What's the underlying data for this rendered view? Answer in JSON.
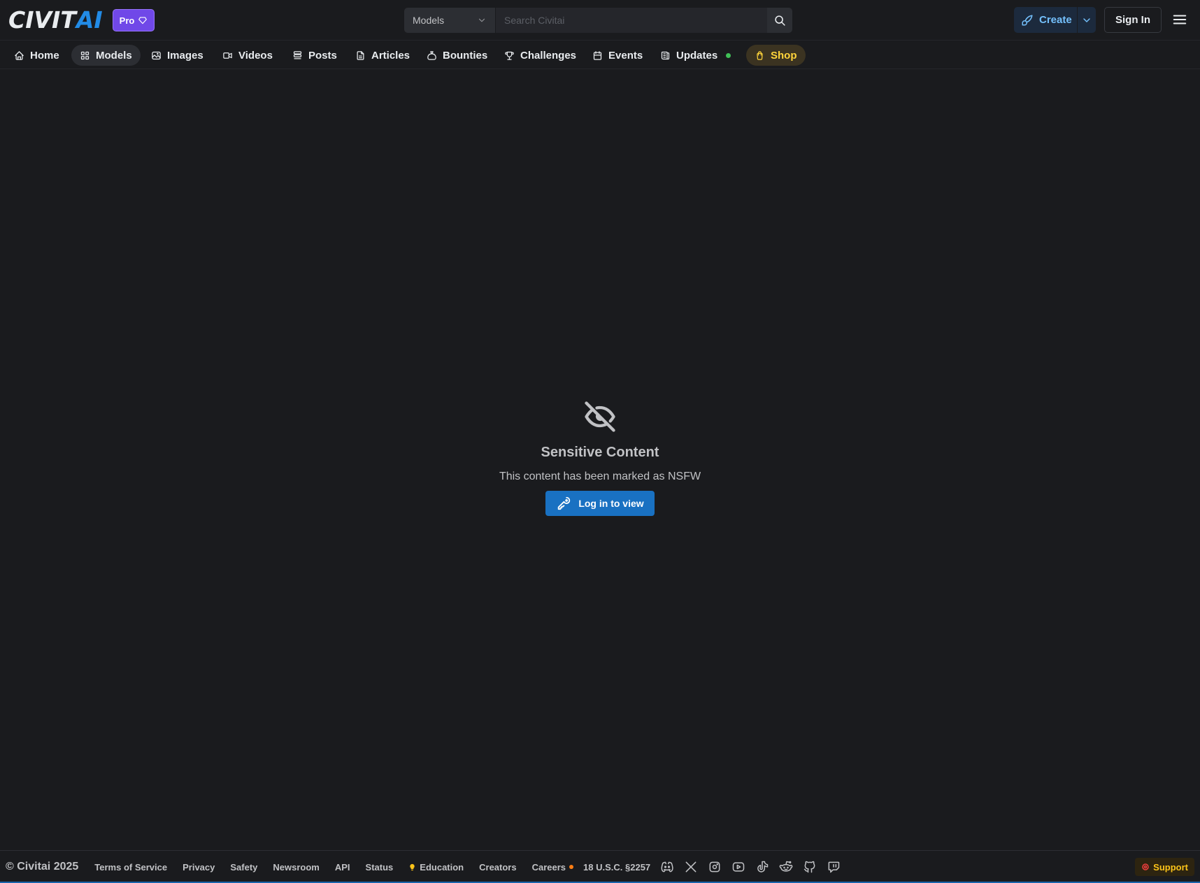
{
  "header": {
    "logo_main": "CIVIT",
    "logo_accent": "AI",
    "pro_label": "Pro",
    "search_type": "Models",
    "search_placeholder": "Search Civitai",
    "search_shortcut": "/",
    "create_label": "Create",
    "signin_label": "Sign In"
  },
  "nav": {
    "items": [
      {
        "label": "Home",
        "icon": "home-icon"
      },
      {
        "label": "Models",
        "icon": "grid-icon"
      },
      {
        "label": "Images",
        "icon": "photo-icon"
      },
      {
        "label": "Videos",
        "icon": "video-icon"
      },
      {
        "label": "Posts",
        "icon": "posts-icon"
      },
      {
        "label": "Articles",
        "icon": "file-text-icon"
      },
      {
        "label": "Bounties",
        "icon": "moneybag-icon"
      },
      {
        "label": "Challenges",
        "icon": "trophy-icon"
      },
      {
        "label": "Events",
        "icon": "calendar-icon"
      },
      {
        "label": "Updates",
        "icon": "news-icon"
      },
      {
        "label": "Shop",
        "icon": "shopping-bag-icon"
      }
    ],
    "active": "Models",
    "updates_dot_color": "#40c057",
    "shop_color": "#ffd43b"
  },
  "main": {
    "icon": "eye-off-icon",
    "title": "Sensitive Content",
    "subtitle": "This content has been marked as NSFW",
    "login_label": "Log in to view"
  },
  "footer": {
    "copyright": "© Civitai 2025",
    "links": {
      "terms": "Terms of Service",
      "privacy": "Privacy",
      "safety": "Safety",
      "newsroom": "Newsroom",
      "api": "API",
      "status": "Status",
      "education": "Education",
      "creators": "Creators",
      "careers": "Careers",
      "usc": "18 U.S.C. §2257"
    },
    "social_icons": [
      "discord-icon",
      "x-icon",
      "instagram-icon",
      "youtube-icon",
      "tiktok-icon",
      "reddit-icon",
      "github-icon",
      "twitch-icon"
    ],
    "support_label": "Support"
  },
  "colors": {
    "background": "#1a1b1e",
    "accent": "#228be6",
    "pro": "#7048e8",
    "login_button": "#1971c2"
  }
}
